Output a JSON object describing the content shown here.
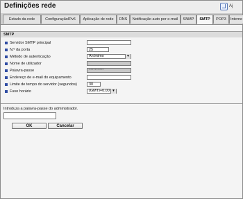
{
  "header": {
    "title": "Definições rede",
    "help_label": "Aj"
  },
  "tabs": [
    {
      "label": "Estado da rede"
    },
    {
      "label": "ConfiguraçãoIPv6"
    },
    {
      "label": "Aplicação de rede"
    },
    {
      "label": "DNS"
    },
    {
      "label": "Notificação auto por e-mail"
    },
    {
      "label": "SNMP"
    },
    {
      "label": "SMTP",
      "active": true
    },
    {
      "label": "POP3"
    },
    {
      "label": "Interne"
    }
  ],
  "section": {
    "title": "SMTP"
  },
  "fields": [
    {
      "label": "Servidor SMTP principal",
      "value": "",
      "type": "text"
    },
    {
      "label": "N.º da porta",
      "value": "25",
      "type": "text"
    },
    {
      "label": "Método de autenticação",
      "value": "Anónimo",
      "type": "select"
    },
    {
      "label": "Nome de utilizador",
      "value": "",
      "type": "disabled"
    },
    {
      "label": "Palavra-passe",
      "value": "**********",
      "type": "disabled"
    },
    {
      "label": "Endereço de e-mail do equipamento",
      "value": "",
      "type": "text"
    },
    {
      "label": "Limite de tempo do servidor (segundos)",
      "value": "30",
      "type": "text"
    },
    {
      "label": "Fuso horário",
      "value": "(GMT)+0.00",
      "type": "select"
    }
  ],
  "admin": {
    "prompt": "Introduza a palavra-passe do administrador.",
    "value": ""
  },
  "buttons": {
    "ok": "OK",
    "cancel": "Cancelar"
  },
  "colors": {
    "background": "#ededed",
    "tab_bar": "#cfcfcf",
    "active_tab": "#f7f7f7",
    "accent": "#2f4ca3"
  }
}
